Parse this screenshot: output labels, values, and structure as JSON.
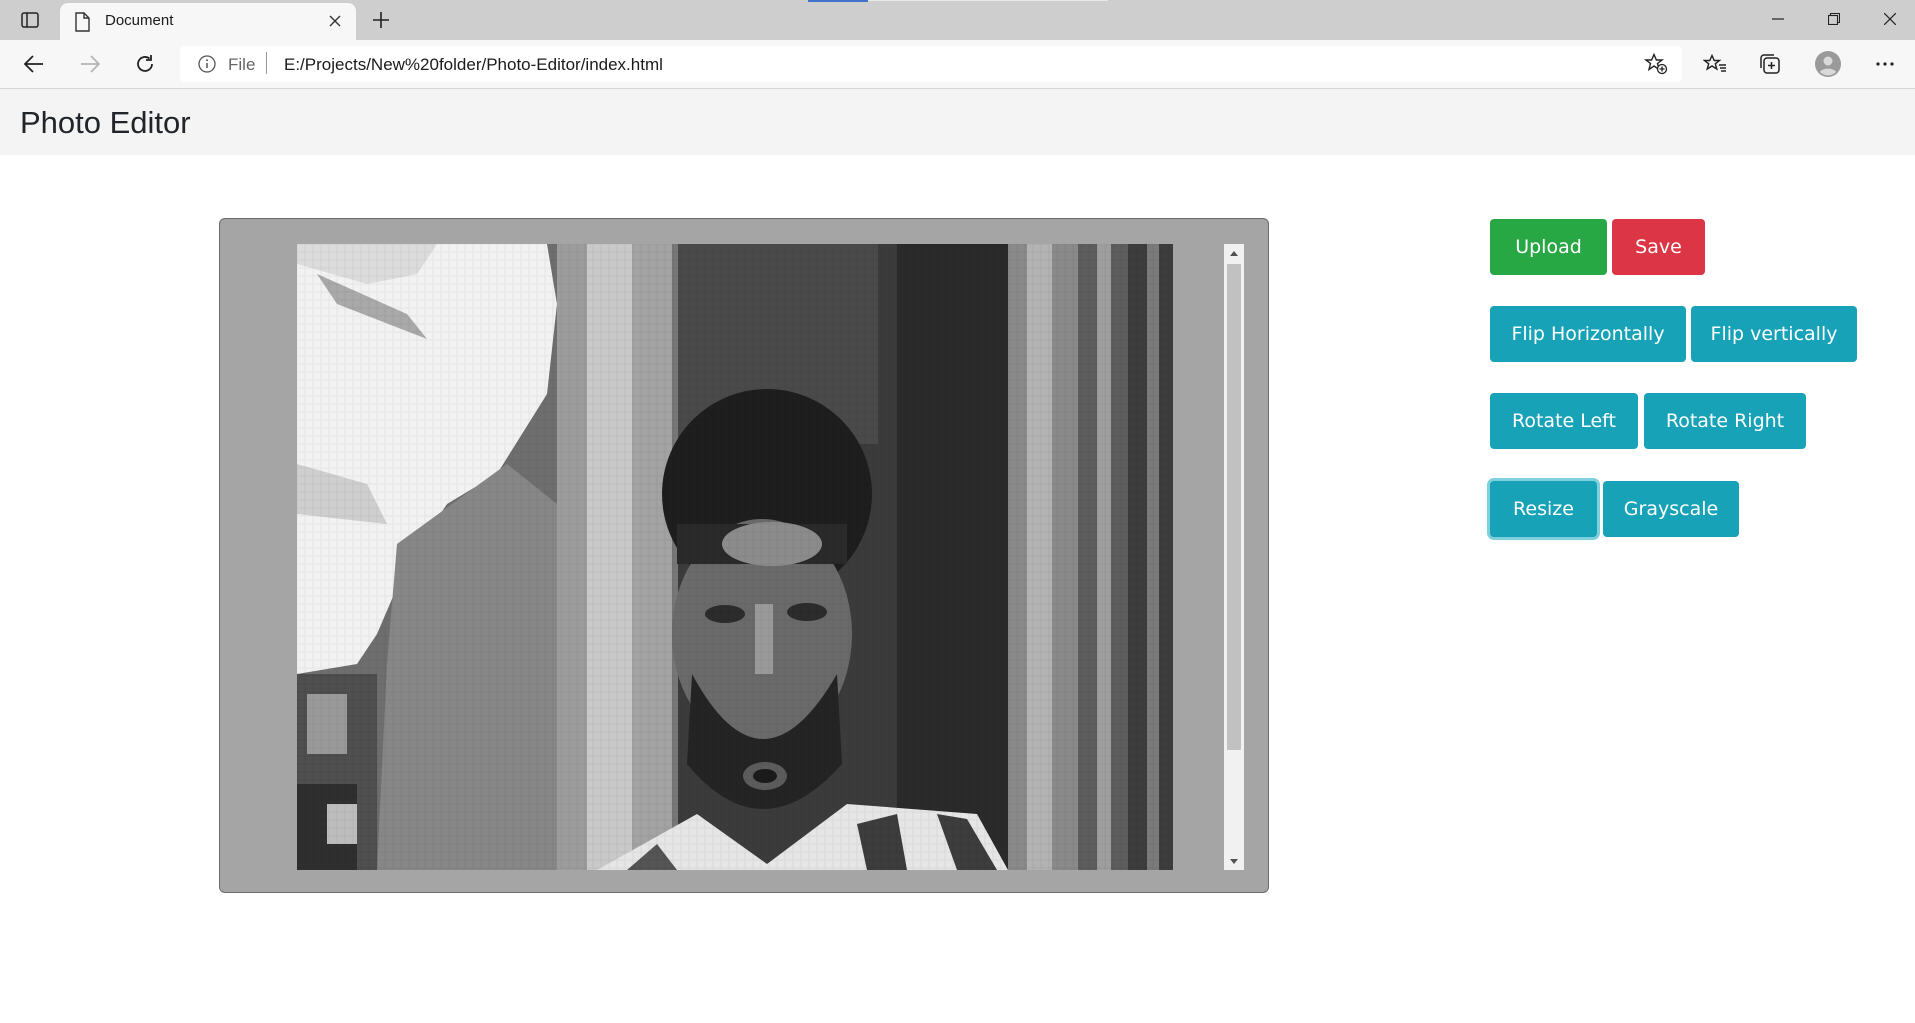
{
  "browser": {
    "tab_title": "Document",
    "address_scheme": "File",
    "address_url": "E:/Projects/New%20folder/Photo-Editor/index.html",
    "icons": [
      "tab-actions-icon",
      "page-icon",
      "close-icon",
      "plus-icon",
      "minimize-icon",
      "restore-icon",
      "window-close-icon",
      "back-arrow-icon",
      "forward-arrow-icon",
      "refresh-icon",
      "info-icon",
      "add-favorite-icon",
      "favorites-icon",
      "collections-icon",
      "profile-icon",
      "more-icon"
    ]
  },
  "page": {
    "title": "Photo Editor",
    "header_bg": "#f4f4f4"
  },
  "editor": {
    "frame_color": "#a5a5a5",
    "image_description_mode": "grayscale pixelated photo"
  },
  "controls": {
    "upload_label": "Upload",
    "save_label": "Save",
    "flip_horizontal_label": "Flip Horizontally",
    "flip_vertical_label": "Flip vertically",
    "rotate_left_label": "Rotate Left",
    "rotate_right_label": "Rotate Right",
    "resize_label": "Resize",
    "grayscale_label": "Grayscale",
    "colors": {
      "success": "#28a745",
      "danger": "#dc3545",
      "info": "#17a2b8"
    }
  }
}
